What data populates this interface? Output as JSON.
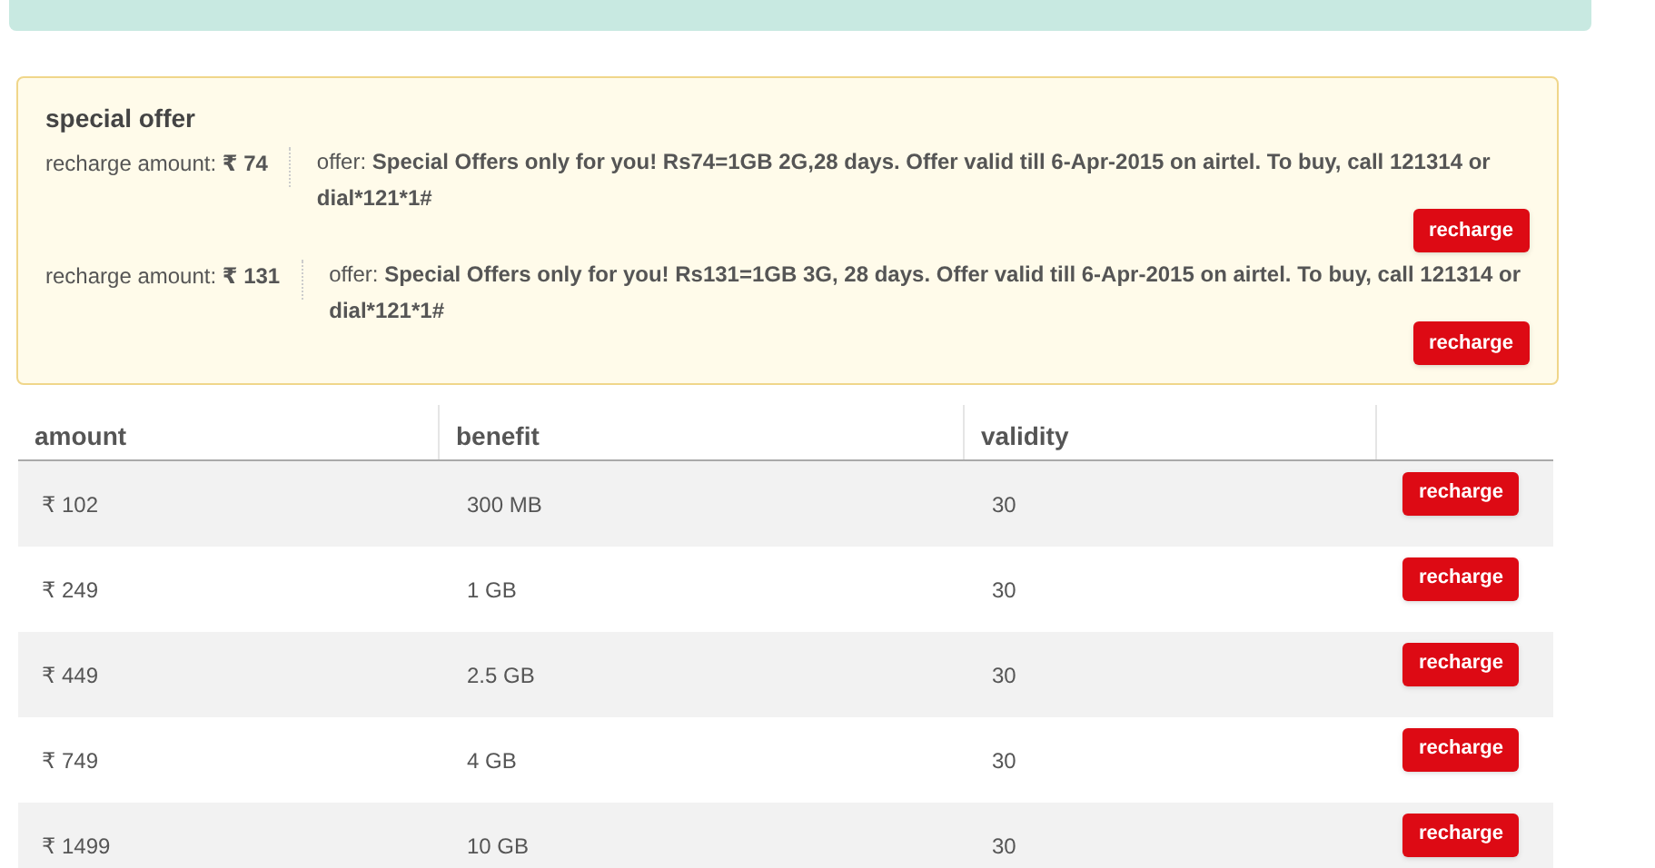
{
  "special_offer": {
    "title": "special offer",
    "offers": [
      {
        "amount": "recharge amount: **₹ 74**",
        "offer": "offer: **Special Offers only for you! Rs74=1GB 2G,28 days. Offer valid till 6-Apr-2015 on airtel. To buy, call 121314 or dial*121*1#**",
        "button": "recharge"
      },
      {
        "amount": "recharge amount: **₹ 131**",
        "offer": "offer: **Special Offers only for you! Rs131=1GB 3G, 28 days. Offer valid till 6-Apr-2015 on airtel. To buy, call 121314 or dial*121*1#**",
        "button": "recharge"
      }
    ]
  },
  "table": {
    "columns": [
      "amount",
      "benefit",
      "validity"
    ],
    "rows": [
      {
        "amount": "₹ 102",
        "benefit": "300 MB",
        "validity": "30",
        "button": "recharge"
      },
      {
        "amount": "₹ 249",
        "benefit": "1 GB",
        "validity": "30",
        "button": "recharge"
      },
      {
        "amount": "₹ 449",
        "benefit": "2.5 GB",
        "validity": "30",
        "button": "recharge"
      },
      {
        "amount": "₹ 749",
        "benefit": "4 GB",
        "validity": "30",
        "button": "recharge"
      },
      {
        "amount": "₹ 1499",
        "benefit": "10 GB",
        "validity": "30",
        "button": "recharge"
      }
    ]
  }
}
